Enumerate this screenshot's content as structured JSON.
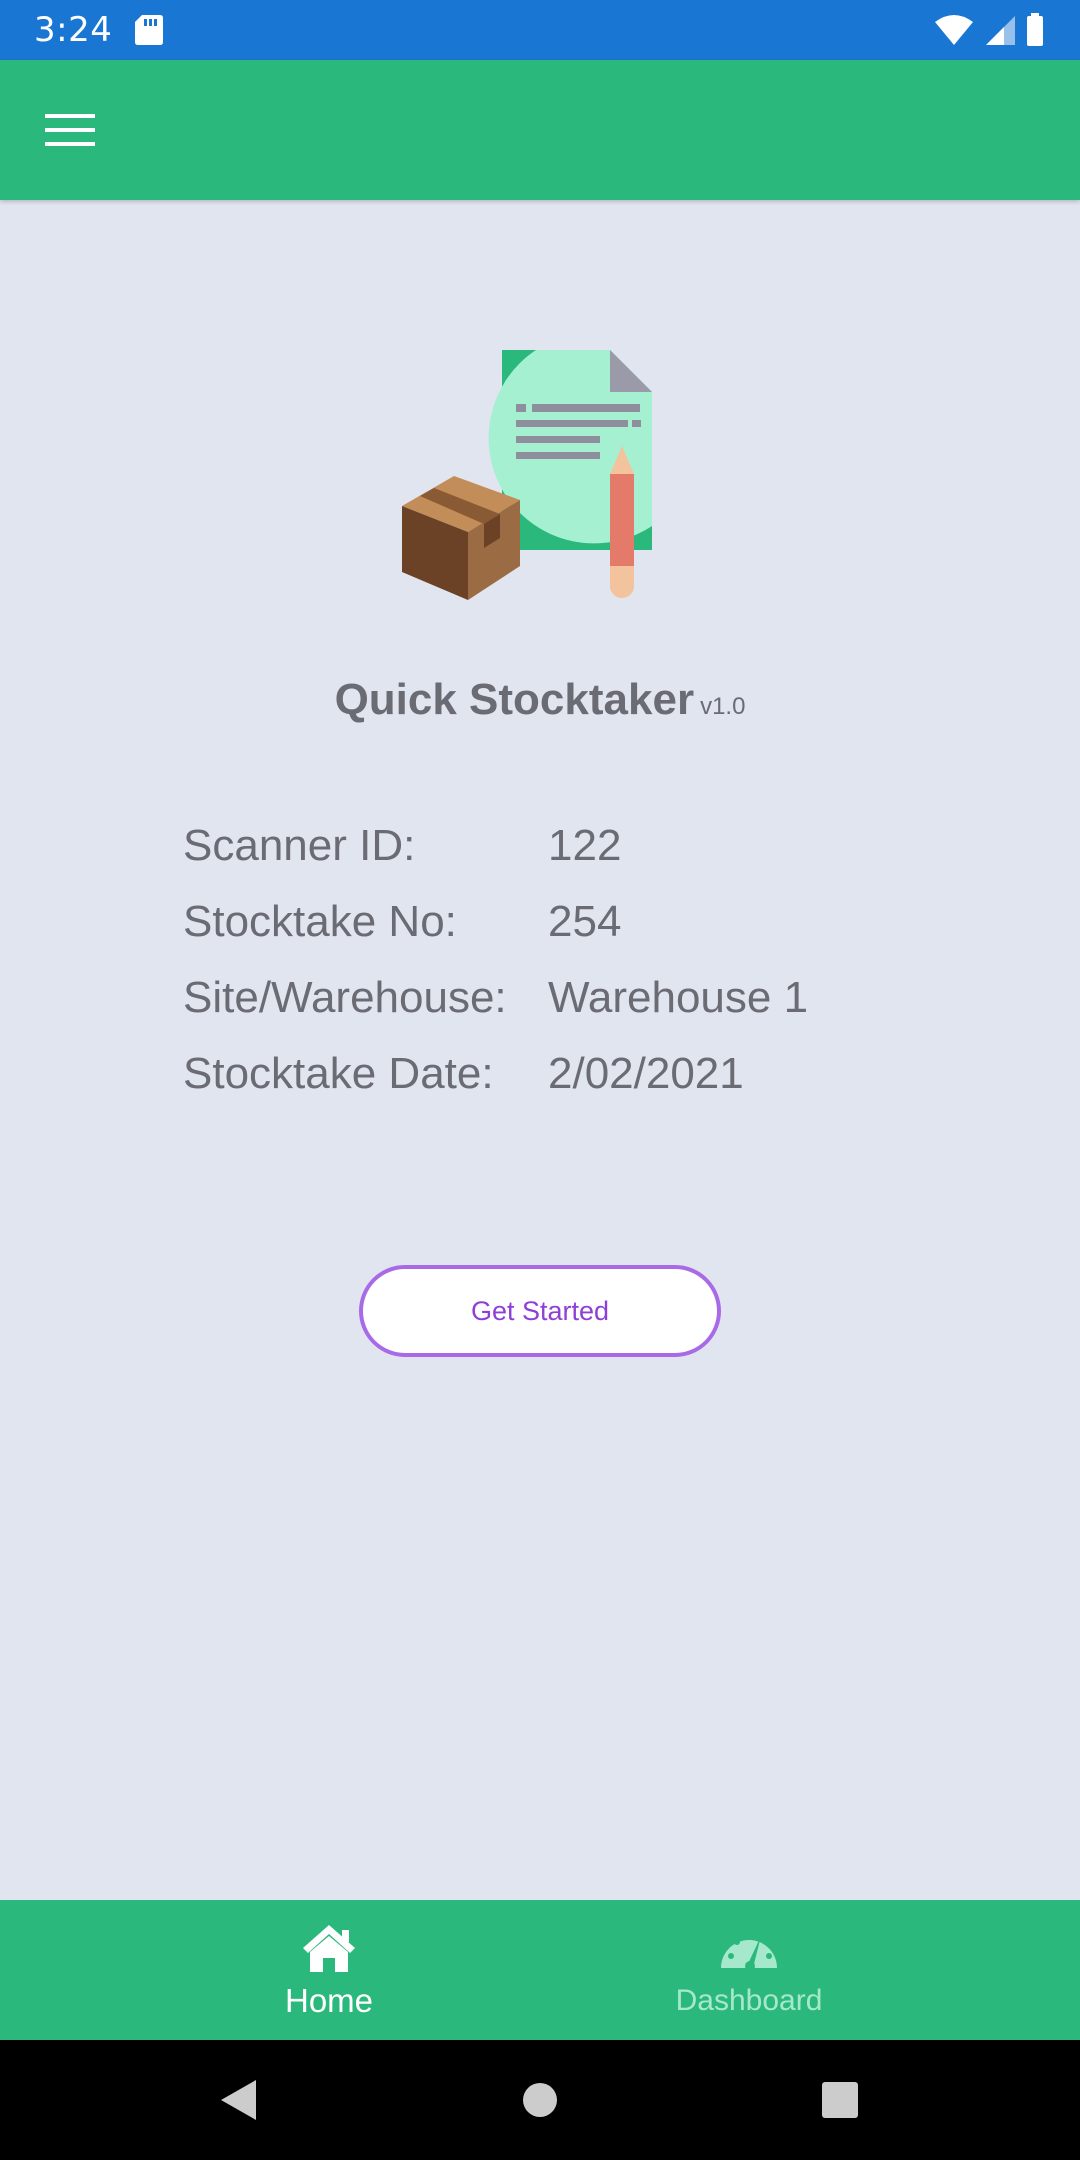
{
  "status_bar": {
    "time": "3:24",
    "icons": [
      "sd-card-icon",
      "wifi-icon",
      "signal-icon",
      "battery-icon"
    ]
  },
  "app_bar": {
    "menu_icon": "hamburger-menu-icon"
  },
  "hero": {
    "illustration": "box-document-pencil-illustration"
  },
  "app": {
    "title": "Quick Stocktaker",
    "version": "v1.0"
  },
  "info": {
    "rows": [
      {
        "label": "Scanner ID:",
        "value": "122"
      },
      {
        "label": "Stocktake No:",
        "value": "254"
      },
      {
        "label": "Site/Warehouse:",
        "value": "Warehouse 1"
      },
      {
        "label": "Stocktake Date:",
        "value": "2/02/2021"
      }
    ]
  },
  "actions": {
    "get_started": "Get Started"
  },
  "bottom_nav": {
    "items": [
      {
        "label": "Home",
        "icon": "home-icon",
        "active": true
      },
      {
        "label": "Dashboard",
        "icon": "dashboard-icon",
        "active": false
      }
    ]
  },
  "system_nav": {
    "icons": [
      "back-icon",
      "home-circle-icon",
      "recents-icon"
    ]
  },
  "colors": {
    "status_bar": "#1976d2",
    "primary": "#2bb87c",
    "background": "#e1e5f0",
    "text": "#6b6b74",
    "button_border": "#a86ae6",
    "button_text": "#8e3fd8",
    "inactive_nav": "#a6e8cb"
  }
}
